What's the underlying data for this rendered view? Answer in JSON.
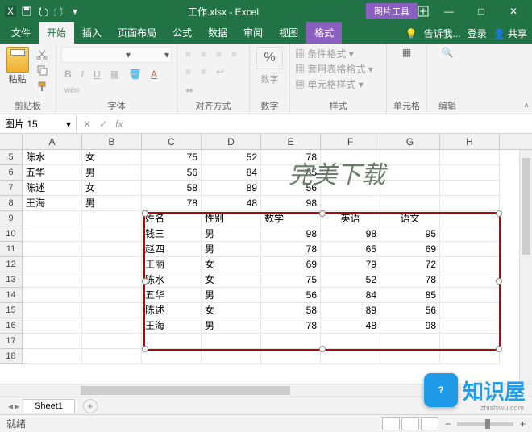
{
  "titlebar": {
    "title": "工作.xlsx - Excel",
    "context_tool": "图片工具"
  },
  "window": {
    "help": "?",
    "restore": "❐",
    "min": "—",
    "max": "□",
    "close": "✕"
  },
  "tabs": {
    "items": [
      "文件",
      "开始",
      "插入",
      "页面布局",
      "公式",
      "数据",
      "审阅",
      "视图"
    ],
    "active": 1,
    "context": "格式",
    "tell_me": "告诉我...",
    "signin": "登录",
    "share": "共享"
  },
  "ribbon": {
    "clipboard": {
      "label": "剪贴板",
      "paste": "粘贴"
    },
    "font": {
      "label": "字体",
      "b": "B",
      "i": "I",
      "u": "U",
      "wen": "wén"
    },
    "align": {
      "label": "对齐方式"
    },
    "number": {
      "label": "数字",
      "btn": "%",
      "sub": "数字"
    },
    "styles": {
      "label": "样式",
      "cond": "条件格式",
      "table": "套用表格格式",
      "cell": "单元格样式"
    },
    "cells": {
      "label": "单元格"
    },
    "edit": {
      "label": "编辑"
    }
  },
  "namebox": {
    "value": "图片 15",
    "fx": "fx",
    "x": "✕",
    "check": "✓"
  },
  "columns": [
    "A",
    "B",
    "C",
    "D",
    "E",
    "F",
    "G",
    "H"
  ],
  "rows_start": 5,
  "main_rows": [
    {
      "n": 5,
      "a": "陈水",
      "b": "女",
      "c": 75,
      "d": 52,
      "e": 78
    },
    {
      "n": 6,
      "a": "五华",
      "b": "男",
      "c": 56,
      "d": 84,
      "e": 85
    },
    {
      "n": 7,
      "a": "陈述",
      "b": "女",
      "c": 58,
      "d": 89,
      "e": 56
    },
    {
      "n": 8,
      "a": "王海",
      "b": "男",
      "c": 78,
      "d": 48,
      "e": 98
    }
  ],
  "inner_header": {
    "name": "姓名",
    "sex": "性别",
    "math": "数学",
    "eng": "英语",
    "chn": "语文"
  },
  "inner_rows": [
    {
      "n": 10,
      "name": "钱三",
      "sex": "男",
      "math": 98,
      "eng": 98,
      "chn": 95
    },
    {
      "n": 11,
      "name": "赵四",
      "sex": "男",
      "math": 78,
      "eng": 65,
      "chn": 69
    },
    {
      "n": 12,
      "name": "王丽",
      "sex": "女",
      "math": 69,
      "eng": 79,
      "chn": 72
    },
    {
      "n": 13,
      "name": "陈水",
      "sex": "女",
      "math": 75,
      "eng": 52,
      "chn": 78
    },
    {
      "n": 14,
      "name": "五华",
      "sex": "男",
      "math": 56,
      "eng": 84,
      "chn": 85
    },
    {
      "n": 15,
      "name": "陈述",
      "sex": "女",
      "math": 58,
      "eng": 89,
      "chn": 56
    },
    {
      "n": 16,
      "name": "王海",
      "sex": "男",
      "math": 78,
      "eng": 48,
      "chn": 98
    }
  ],
  "blank_rows": [
    17,
    18
  ],
  "watermark": "完美下载",
  "sheetbar": {
    "sheet": "Sheet1",
    "add": "+"
  },
  "statusbar": {
    "ready": "就绪",
    "zoom_minus": "−",
    "zoom_plus": "+"
  },
  "brand": {
    "name": "知识屋",
    "q": "?",
    "sub": "zhishiwu.com"
  }
}
